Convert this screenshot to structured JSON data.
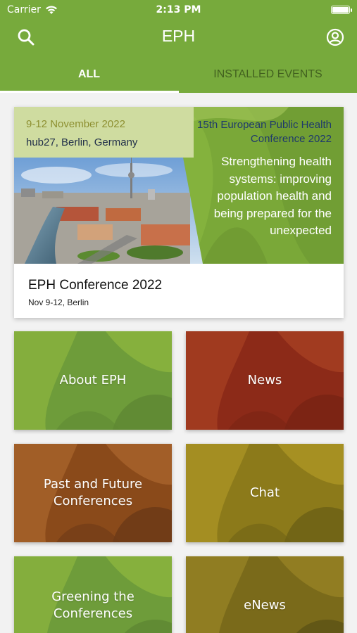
{
  "status_bar": {
    "carrier": "Carrier",
    "time": "2:13 PM"
  },
  "navbar": {
    "title": "EPH",
    "left_icon": "search-icon",
    "right_icon": "profile-icon"
  },
  "tabs": [
    {
      "label": "ALL",
      "active": true
    },
    {
      "label": "INSTALLED EVENTS",
      "active": false
    }
  ],
  "featured_event": {
    "banner": {
      "date": "9-12 November 2022",
      "venue": "hub27, Berlin, Germany",
      "conference_title": "15th European Public Health Conference 2022",
      "tagline": "Strengthening health systems: improving population health and being prepared for the unexpected"
    },
    "name": "EPH Conference 2022",
    "subtitle": "Nov 9-12, Berlin"
  },
  "tiles": [
    {
      "label": "About EPH",
      "base": "#6e9c3a",
      "shade1": "#88b23e",
      "shade2": "#5f8a34"
    },
    {
      "label": "News",
      "base": "#8c2a18",
      "shade1": "#a33d21",
      "shade2": "#7a2414"
    },
    {
      "label": "Past and Future Conferences",
      "base": "#8a4a1a",
      "shade1": "#a4612a",
      "shade2": "#6e3b17"
    },
    {
      "label": "Chat",
      "base": "#8c7a1a",
      "shade1": "#a89224",
      "shade2": "#6f6316"
    },
    {
      "label": "Greening the Conferences",
      "base": "#6e9c3a",
      "shade1": "#88b23e",
      "shade2": "#5f8a34"
    },
    {
      "label": "eNews",
      "base": "#7a6a1a",
      "shade1": "#948024",
      "shade2": "#5f5516"
    }
  ],
  "colors": {
    "header_green": "#77aa3c",
    "banner_green": "#84b23d",
    "inactive_tab_text": "#39551b"
  }
}
